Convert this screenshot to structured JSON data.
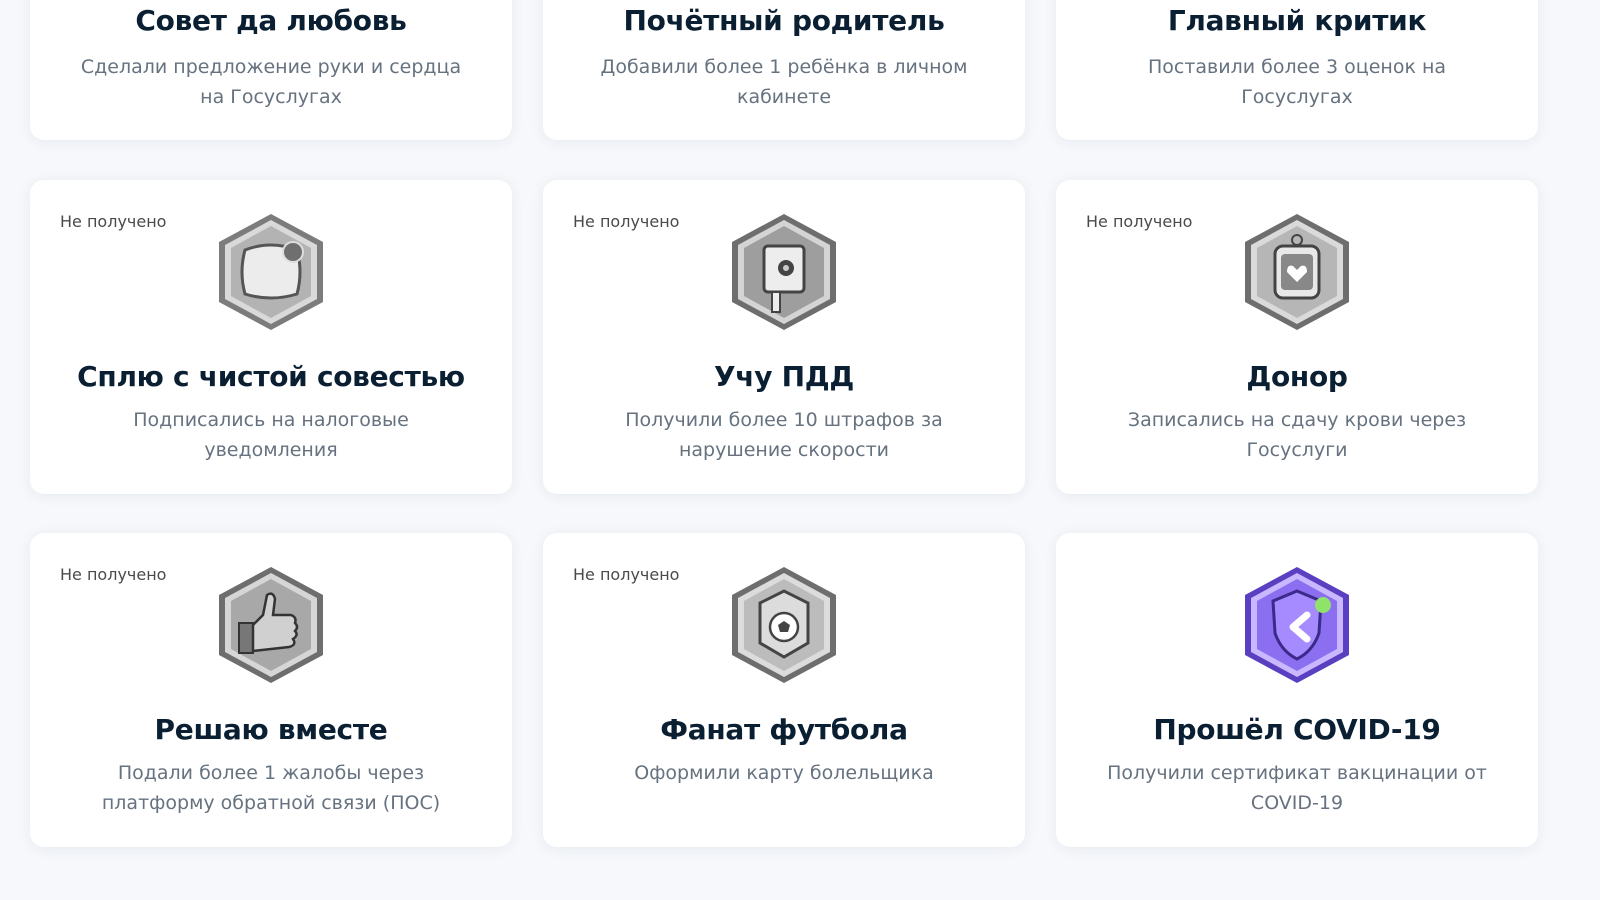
{
  "achievements": [
    {
      "title": "Совет да любовь",
      "desc": "Сделали предложение руки и сердца на Госуслугах"
    },
    {
      "title": "Почётный родитель",
      "desc": "Добавили более 1 ребёнка в личном кабинете"
    },
    {
      "title": "Главный критик",
      "desc": "Поставили более 3 оценок на Госуслугах"
    },
    {
      "status": "Не получено",
      "badge_icon": "pillow-icon",
      "title": "Сплю с чистой совестью",
      "desc": "Подписались на налоговые уведомления"
    },
    {
      "status": "Не получено",
      "badge_icon": "traffic-camera-icon",
      "title": "Учу ПДД",
      "desc": "Получили более 10 штрафов за нарушение скорости"
    },
    {
      "status": "Не получено",
      "badge_icon": "blood-bag-icon",
      "title": "Донор",
      "desc": "Записались на сдачу крови через Госуслуги"
    },
    {
      "status": "Не получено",
      "badge_icon": "thumbs-up-icon",
      "title": "Решаю вместе",
      "desc": "Подали более 1 жалобы через платформу обратной связи (ПОС)"
    },
    {
      "status": "Не получено",
      "badge_icon": "football-icon",
      "title": "Фанат футбола",
      "desc": "Оформили карту болельщика"
    },
    {
      "badge_icon": "shield-icon",
      "title": "Прошёл COVID-19",
      "desc": "Получили сертификат вакцинации от COVID-19"
    }
  ],
  "colors": {
    "badge_locked": "#9a9a9a",
    "badge_earned": "#8b6ff0",
    "status_text": "#4a4a4a",
    "title_text": "#0b1f33",
    "desc_text": "#66727f"
  }
}
